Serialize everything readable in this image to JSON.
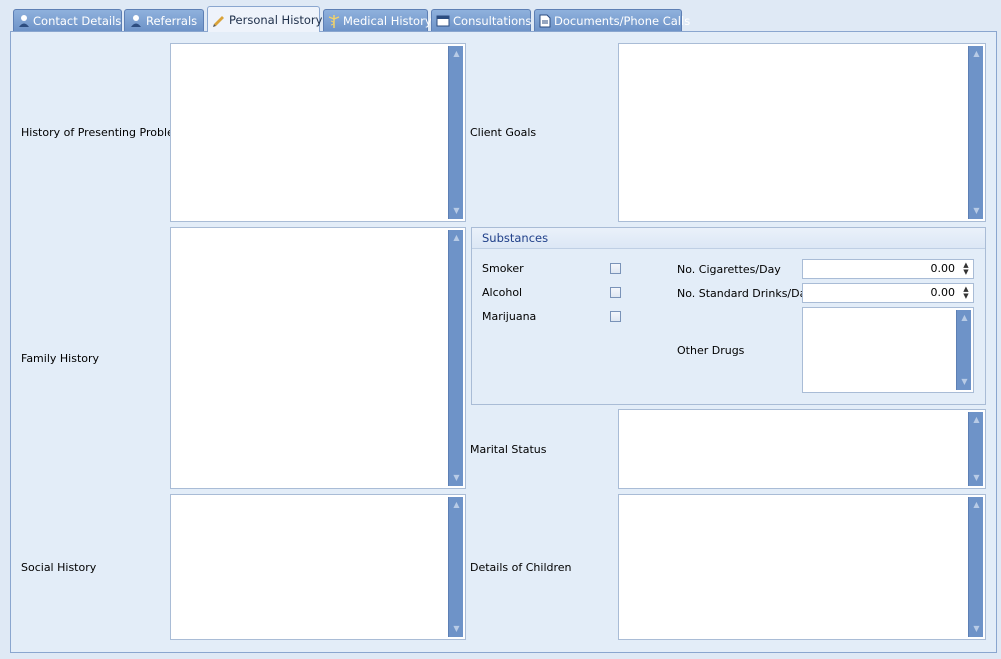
{
  "tabs": [
    {
      "label": "Contact Details",
      "icon": "person-icon"
    },
    {
      "label": "Referrals",
      "icon": "person-icon"
    },
    {
      "label": "Personal History",
      "icon": "pencil-icon"
    },
    {
      "label": "Medical History",
      "icon": "caduceus-icon"
    },
    {
      "label": "Consultations",
      "icon": "calendar-icon"
    },
    {
      "label": "Documents/Phone Calls",
      "icon": "document-icon"
    }
  ],
  "active_tab": "Personal History",
  "fields": {
    "history_presenting": "History of Presenting Problem",
    "family_history": "Family History",
    "social_history": "Social History",
    "client_goals": "Client Goals",
    "marital_status": "Marital Status",
    "details_children": "Details of Children"
  },
  "substances": {
    "title": "Substances",
    "smoker": "Smoker",
    "alcohol": "Alcohol",
    "marijuana": "Marijuana",
    "cigarettes_label": "No. Cigarettes/Day",
    "cigarettes_value": "0.00",
    "drinks_label": "No. Standard Drinks/Day",
    "drinks_value": "0.00",
    "other_drugs": "Other Drugs"
  },
  "colors": {
    "tab_bg": "#6e93c8",
    "scrollbar": "#6e93c8",
    "panel_bg": "#e3edf8",
    "group_title": "#20408a"
  }
}
